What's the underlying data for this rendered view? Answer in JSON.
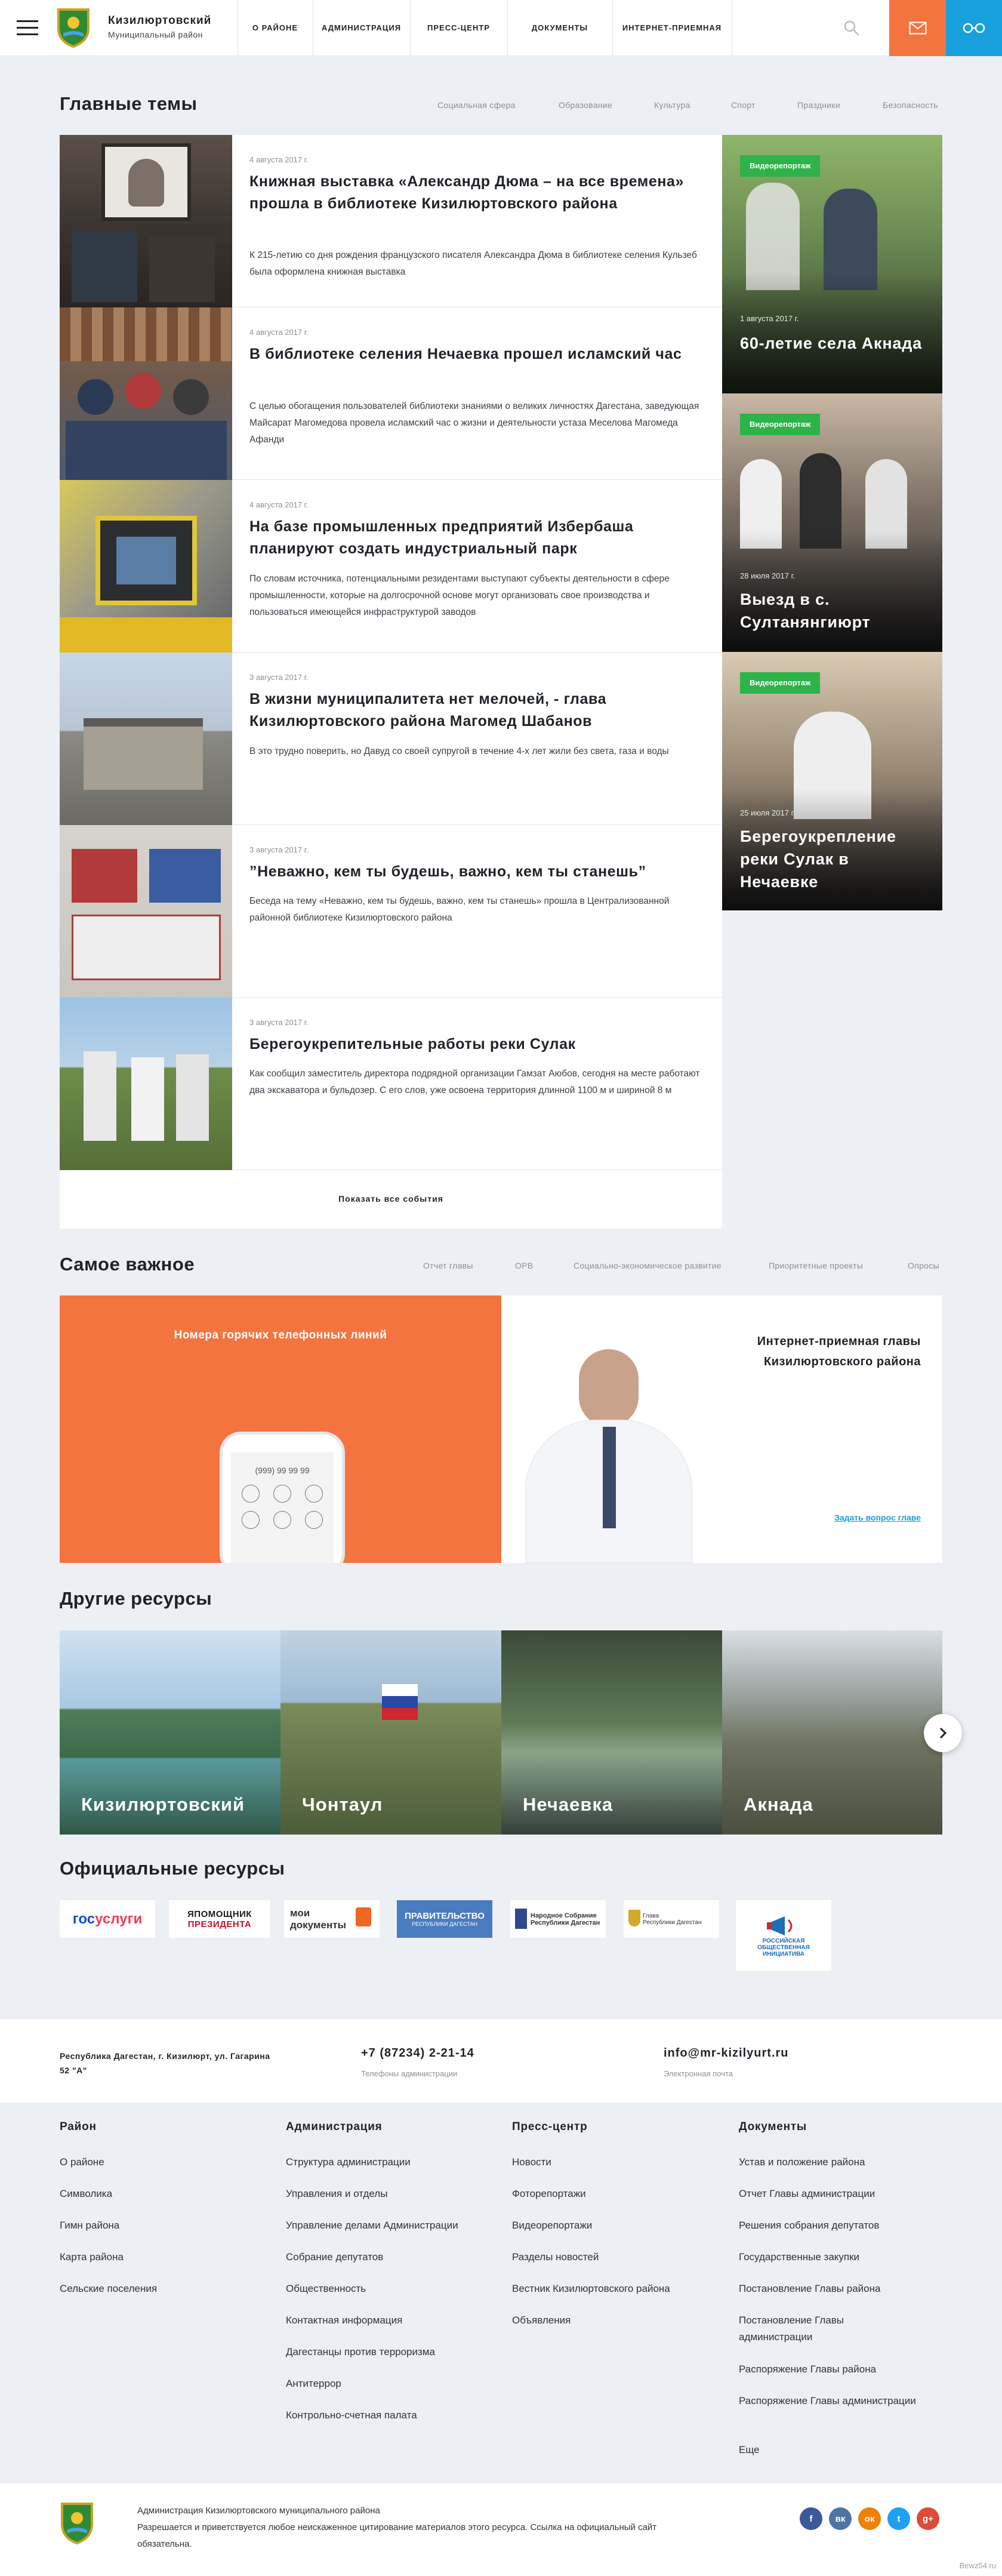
{
  "header": {
    "title": "Кизилюртовский",
    "subtitle": "Муниципальный район",
    "nav": [
      "О РАЙОНЕ",
      "АДМИНИСТРАЦИЯ",
      "ПРЕСС-ЦЕНТР",
      "ДОКУМЕНТЫ",
      "ИНТЕРНЕТ-ПРИЕМНАЯ"
    ],
    "colors": {
      "mail": "#f47440",
      "glasses": "#18a0dd"
    }
  },
  "main_topics": {
    "title": "Главные темы",
    "tabs": [
      "Социальная сфера",
      "Образование",
      "Культура",
      "Спорт",
      "Праздники",
      "Безопасность"
    ],
    "news": [
      {
        "date": "4 августа 2017 г.",
        "title": "Книжная выставка «Александр Дюма – на все времена» прошла в библиотеке Кизилюртовского района",
        "text": "К 215-летию со дня рождения французского писателя Александра Дюма в библиотеке селения Кульзеб была оформлена книжная выставка"
      },
      {
        "date": "4 августа 2017 г.",
        "title": "В библиотеке селения Нечаевка прошел исламский час",
        "text": "С целью обогащения пользователей библиотеки знаниями о великих личностях Дагестана, заведующая Майсарат Магомедова провела исламский час о жизни и деятельности устаза Меселова Магомеда Афанди"
      },
      {
        "date": "4 августа 2017 г.",
        "title": "На базе промышленных предприятий Избербаша планируют создать индустриальный парк",
        "text": "По словам источника, потенциальными резидентами выступают субъекты деятельности в сфере промышленности, которые на долгосрочной основе могут организовать свое производства и пользоваться имеющейся инфраструктурой заводов"
      },
      {
        "date": "3 августа 2017 г.",
        "title": "В жизни муниципалитета нет мелочей, - глава Кизилюртовского района Магомед Шабанов",
        "text": "В это трудно поверить, но Давуд со своей супругой в течение 4-х лет жили без света, газа и воды"
      },
      {
        "date": "3 августа 2017 г.",
        "title": "”Неважно, кем ты будешь, важно, кем ты станешь”",
        "text": "Беседа на тему «Неважно, кем ты будешь, важно, кем ты станешь» прошла в Централизованной районной библиотеке Кизилюртовского района"
      },
      {
        "date": "3 августа 2017 г.",
        "title": "Берегоукрепительные работы реки Сулак",
        "text": "Как сообщил заместитель директора подрядной организации Гамзат Аюбов, сегодня на месте работают два экскаватора и бульдозер. С его слов, уже освоена территория длинной 1100 м и шириной 8 м"
      }
    ],
    "show_all": "Показать все события",
    "video": [
      {
        "badge": "Видеорепортаж",
        "date": "1 августа 2017 г.",
        "title": "60-летие села Акнада"
      },
      {
        "badge": "Видеорепортаж",
        "date": "28 июля 2017 г.",
        "title": "Выезд в с. Султанянгиюрт"
      },
      {
        "badge": "Видеорепортаж",
        "date": "25 июля 2017 г.",
        "title": "Берегоукрепление реки Сулак в Нечаевке"
      }
    ]
  },
  "important": {
    "title": "Самое важное",
    "tabs": [
      "Отчет главы",
      "ОРВ",
      "Социально-экономическое развитие",
      "Приоритетные проекты",
      "Опросы"
    ],
    "hotline_title": "Номера горячих телефонных линий",
    "phone_screen": "(999) 99 99 99",
    "reception_title": "Интернет-приемная главы Кизилюртовского района",
    "reception_link": "Задать вопрос главе"
  },
  "other_resources": {
    "title": "Другие ресурсы",
    "items": [
      "Кизилюртовский",
      "Чонтаул",
      "Нечаевка",
      "Акнада"
    ]
  },
  "official_resources": {
    "title": "Официальные ресурсы",
    "logos": {
      "gosuslugi_a": "гос",
      "gosuslugi_b": "услуги",
      "pomoshnik_a": "ЯПОМОЩНИК",
      "pomoshnik_b": "ПРЕЗИДЕНТА",
      "moi_docs_a": "мои",
      "moi_docs_b": "документы",
      "government_a": "ПРАВИТЕЛЬСТВО",
      "government_b": "РЕСПУБЛИКИ ДАГЕСТАН",
      "assembly_a": "Народное Собрание",
      "assembly_b": "Республики Дагестан",
      "head_a": "Глава",
      "head_b": "Республики Дагестан",
      "roi_a": "РОССИЙСКАЯ",
      "roi_b": "ОБЩЕСТВЕННАЯ",
      "roi_c": "ИНИЦИАТИВА"
    }
  },
  "contacts": {
    "address": "Республика Дагестан, г. Кизилюрт, ул. Гагарина 52 \"А\"",
    "phone": "+7 (87234) 2-21-14",
    "phone_caption": "Телефоны администрации",
    "email": "info@mr-kizilyurt.ru",
    "email_caption": "Электронная почта"
  },
  "footer": {
    "columns": [
      {
        "title": "Район",
        "items": [
          "О районе",
          "Символика",
          "Гимн района",
          "Карта района",
          "Сельские поселения"
        ]
      },
      {
        "title": "Администрация",
        "items": [
          "Структура администрации",
          "Управления и отделы",
          "Управление делами Администрации",
          "Собрание депутатов",
          "Общественность",
          "Контактная информация",
          "Дагестанцы против терроризма",
          "Антитеррор",
          "Контрольно-счетная палата"
        ]
      },
      {
        "title": "Пресс-центр",
        "items": [
          "Новости",
          "Фоторепортажи",
          "Видеорепортажи",
          "Разделы новостей",
          "Вестник Кизилюртовского района",
          "Объявления"
        ]
      },
      {
        "title": "Документы",
        "items": [
          "Устав и положение района",
          "Отчет Главы администрации",
          "Решения собрания депутатов",
          "Государственные закупки",
          "Постановление Главы района",
          "Постановление Главы администрации",
          "Распоряжение Главы района",
          "Распоряжение Главы администрации",
          "Еще"
        ]
      }
    ],
    "copyright": "Администрация Кизилюртовского муниципального района",
    "notice": "Разрешается и приветствуется любое неискаженное цитирование материалов этого ресурса. Ссылка на официальный сайт обязательна.",
    "social": [
      {
        "icon": "facebook-icon",
        "glyph": "f",
        "color": "#3b5998"
      },
      {
        "icon": "vk-icon",
        "glyph": "вк",
        "color": "#4c75a3"
      },
      {
        "icon": "odnoklassniki-icon",
        "glyph": "ок",
        "color": "#ee8208"
      },
      {
        "icon": "twitter-icon",
        "glyph": "t",
        "color": "#1da1f2"
      },
      {
        "icon": "google-plus-icon",
        "glyph": "g+",
        "color": "#dd4b39"
      }
    ],
    "credit": "Bewz54.ru"
  }
}
